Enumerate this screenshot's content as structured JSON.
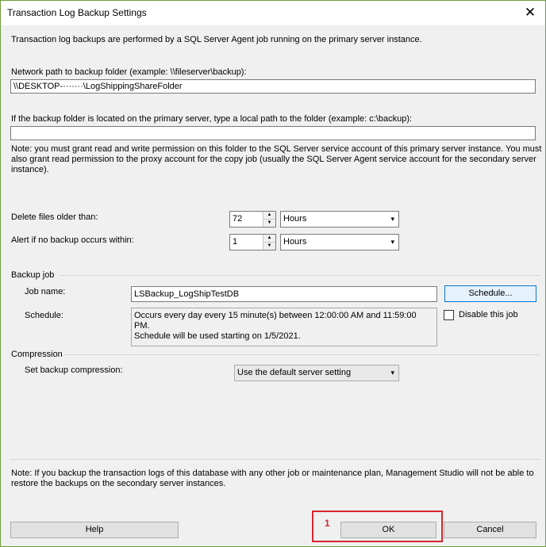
{
  "window": {
    "title": "Transaction Log Backup Settings",
    "close_glyph": "✕"
  },
  "intro": "Transaction log backups are performed by a SQL Server Agent job running on the primary server instance.",
  "network_path": {
    "label": "Network path to backup folder (example: \\\\fileserver\\backup):",
    "value": "\\\\DESKTOP-·······\\LogShippingShareFolder"
  },
  "local_path": {
    "label": "If the backup folder is located on the primary server, type a local path to the folder (example: c:\\backup):",
    "value": ""
  },
  "permission_note": {
    "line1": "Note: you must grant read and write permission on this folder to the SQL Server service account of this primary server instance.  You must",
    "line2": "also grant read permission to the proxy account for the copy job (usually the SQL Server Agent service account for the secondary server",
    "line3": "instance)."
  },
  "delete_files": {
    "label": "Delete files older than:",
    "value": "72",
    "unit": "Hours"
  },
  "alert": {
    "label": "Alert if no backup occurs within:",
    "value": "1",
    "unit": "Hours"
  },
  "backup_job": {
    "group_label": "Backup job",
    "job_name_label": "Job name:",
    "job_name_value": "LSBackup_LogShipTestDB",
    "schedule_button": "Schedule...",
    "schedule_label": "Schedule:",
    "schedule_line1": "Occurs every day every 15 minute(s) between 12:00:00 AM and 11:59:00 PM.",
    "schedule_line2": "Schedule will be used starting on 1/5/2021.",
    "disable_label": "Disable this job",
    "disable_checked": false
  },
  "compression": {
    "group_label": "Compression",
    "label": "Set backup compression:",
    "value": "Use the default server setting"
  },
  "bottom_note": {
    "line1": "Note: If you backup the transaction logs of this database with any other job or maintenance plan, Management Studio will not be able to",
    "line2": "restore the backups on the secondary server instances."
  },
  "buttons": {
    "help": "Help",
    "ok": "OK",
    "cancel": "Cancel"
  },
  "annotation": {
    "number": "1",
    "color": "#d7262c"
  },
  "icons": {
    "dropdown": "▾",
    "spin_up": "▲",
    "spin_down": "▼"
  }
}
